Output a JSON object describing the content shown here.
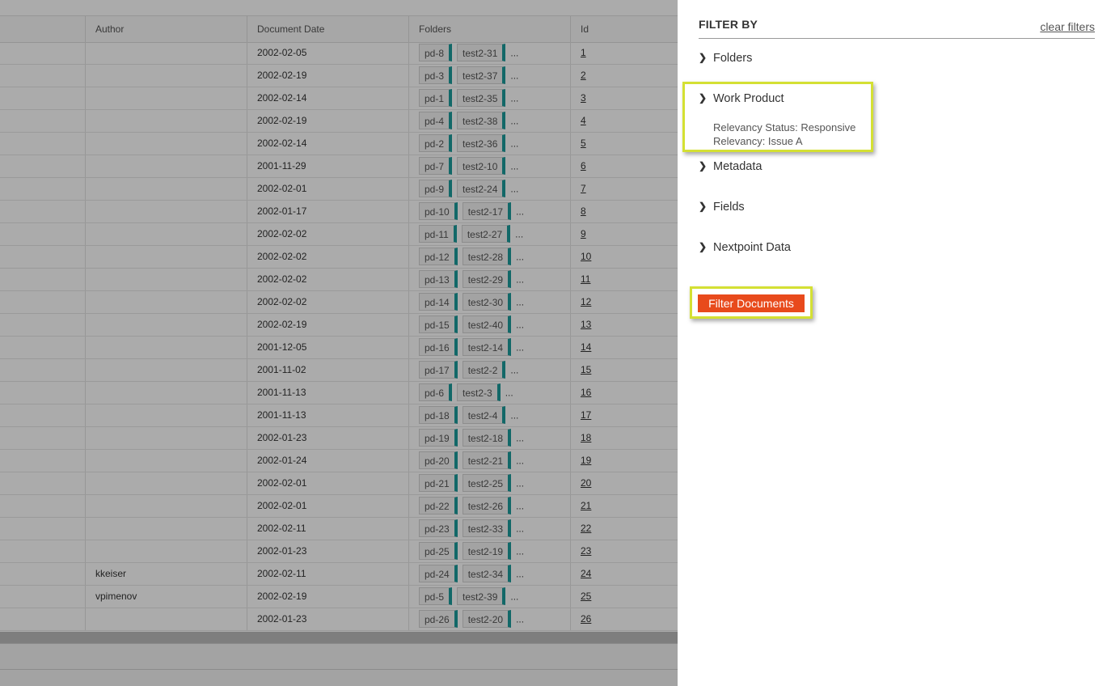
{
  "table": {
    "columns": {
      "author": "Author",
      "document_date": "Document Date",
      "folders": "Folders",
      "id": "Id"
    },
    "rows": [
      {
        "author": "",
        "date": "2002-02-05",
        "f1": "pd-8",
        "f2": "test2-31",
        "id": "1"
      },
      {
        "author": "",
        "date": "2002-02-19",
        "f1": "pd-3",
        "f2": "test2-37",
        "id": "2"
      },
      {
        "author": "",
        "date": "2002-02-14",
        "f1": "pd-1",
        "f2": "test2-35",
        "id": "3"
      },
      {
        "author": "",
        "date": "2002-02-19",
        "f1": "pd-4",
        "f2": "test2-38",
        "id": "4"
      },
      {
        "author": "",
        "date": "2002-02-14",
        "f1": "pd-2",
        "f2": "test2-36",
        "id": "5"
      },
      {
        "author": "",
        "date": "2001-11-29",
        "f1": "pd-7",
        "f2": "test2-10",
        "id": "6"
      },
      {
        "author": "",
        "date": "2002-02-01",
        "f1": "pd-9",
        "f2": "test2-24",
        "id": "7"
      },
      {
        "author": "",
        "date": "2002-01-17",
        "f1": "pd-10",
        "f2": "test2-17",
        "id": "8"
      },
      {
        "author": "",
        "date": "2002-02-02",
        "f1": "pd-11",
        "f2": "test2-27",
        "id": "9"
      },
      {
        "author": "",
        "date": "2002-02-02",
        "f1": "pd-12",
        "f2": "test2-28",
        "id": "10"
      },
      {
        "author": "",
        "date": "2002-02-02",
        "f1": "pd-13",
        "f2": "test2-29",
        "id": "11"
      },
      {
        "author": "",
        "date": "2002-02-02",
        "f1": "pd-14",
        "f2": "test2-30",
        "id": "12"
      },
      {
        "author": "",
        "date": "2002-02-19",
        "f1": "pd-15",
        "f2": "test2-40",
        "id": "13"
      },
      {
        "author": "",
        "date": "2001-12-05",
        "f1": "pd-16",
        "f2": "test2-14",
        "id": "14"
      },
      {
        "author": "",
        "date": "2001-11-02",
        "f1": "pd-17",
        "f2": "test2-2",
        "id": "15"
      },
      {
        "author": "",
        "date": "2001-11-13",
        "f1": "pd-6",
        "f2": "test2-3",
        "id": "16"
      },
      {
        "author": "",
        "date": "2001-11-13",
        "f1": "pd-18",
        "f2": "test2-4",
        "id": "17"
      },
      {
        "author": "",
        "date": "2002-01-23",
        "f1": "pd-19",
        "f2": "test2-18",
        "id": "18"
      },
      {
        "author": "",
        "date": "2002-01-24",
        "f1": "pd-20",
        "f2": "test2-21",
        "id": "19"
      },
      {
        "author": "",
        "date": "2002-02-01",
        "f1": "pd-21",
        "f2": "test2-25",
        "id": "20"
      },
      {
        "author": "",
        "date": "2002-02-01",
        "f1": "pd-22",
        "f2": "test2-26",
        "id": "21"
      },
      {
        "author": "",
        "date": "2002-02-11",
        "f1": "pd-23",
        "f2": "test2-33",
        "id": "22"
      },
      {
        "author": "",
        "date": "2002-01-23",
        "f1": "pd-25",
        "f2": "test2-19",
        "id": "23"
      },
      {
        "author": "kkeiser",
        "date": "2002-02-11",
        "f1": "pd-24",
        "f2": "test2-34",
        "id": "24"
      },
      {
        "author": "vpimenov",
        "date": "2002-02-19",
        "f1": "pd-5",
        "f2": "test2-39",
        "id": "25"
      },
      {
        "author": "",
        "date": "2002-01-23",
        "f1": "pd-26",
        "f2": "test2-20",
        "id": "26"
      }
    ],
    "more_label": "..."
  },
  "filter_panel": {
    "title": "FILTER BY",
    "clear_label": "clear filters",
    "sections": {
      "folders": "Folders",
      "work_product": "Work Product",
      "metadata": "Metadata",
      "fields": "Fields",
      "nextpoint_data": "Nextpoint Data"
    },
    "work_product_selected": [
      "Relevancy Status: Responsive",
      "Relevancy: Issue A"
    ],
    "submit_label": "Filter Documents"
  },
  "colors": {
    "highlight": "#d4e033",
    "primary_button": "#e84a1c",
    "folder_tag_accent": "#1c9c9c"
  }
}
